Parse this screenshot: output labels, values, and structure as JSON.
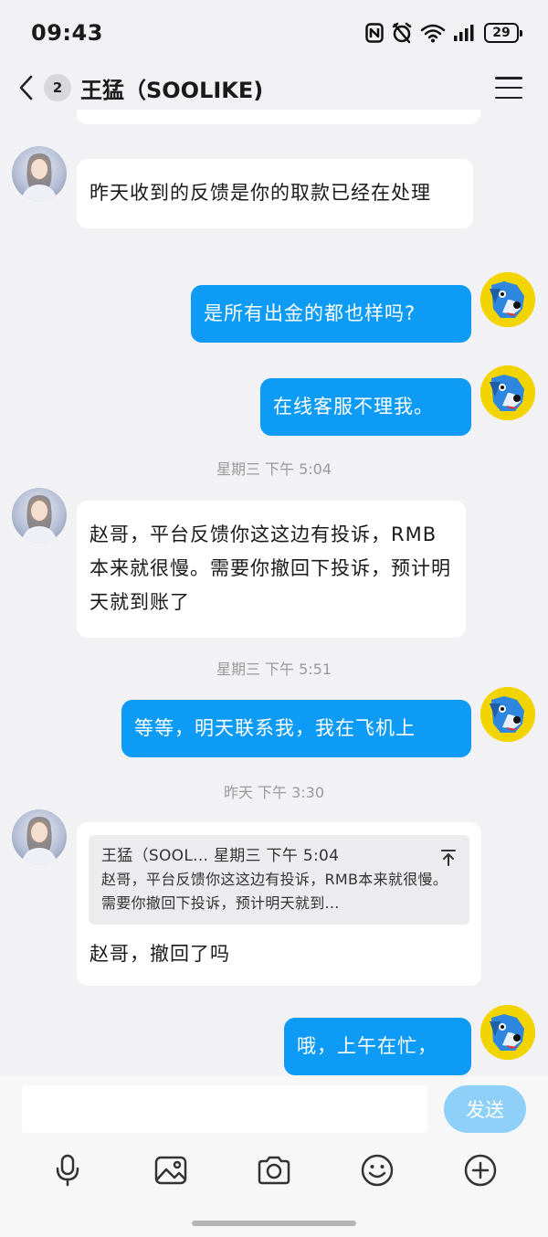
{
  "status_bar": {
    "time": "09:43",
    "battery": "29",
    "icons": [
      "nfc-icon",
      "alarm-off-icon",
      "wifi-icon",
      "signal-icon",
      "battery-icon"
    ]
  },
  "nav": {
    "unread_count": "2",
    "title": "王猛（SOOLIKE)"
  },
  "messages": [
    {
      "side": "in",
      "text": "昨天收到的反馈是你的取款已经在处理"
    },
    {
      "side": "out",
      "text": "是所有出金的都也样吗?"
    },
    {
      "side": "out",
      "text": "在线客服不理我。"
    },
    {
      "type": "time",
      "text": "星期三 下午 5:04"
    },
    {
      "side": "in",
      "text": "赵哥，平台反馈你这这边有投诉，RMB本来就很慢。需要你撤回下投诉，预计明天就到账了"
    },
    {
      "type": "time",
      "text": "星期三 下午 5:51"
    },
    {
      "side": "out",
      "text": "等等，明天联系我，我在飞机上"
    },
    {
      "type": "time",
      "text": "昨天 下午 3:30"
    },
    {
      "side": "in",
      "quote": {
        "head": "王猛（SOOL... 星期三 下午 5:04",
        "body": "赵哥，平台反馈你这这边有投诉，RMB本来就很慢。需要你撤回下投诉，预计明天就到..."
      },
      "text": "赵哥，撤回了吗"
    },
    {
      "side": "out",
      "text": "哦，上午在忙，"
    }
  ],
  "input": {
    "value": "",
    "send_label": "发送"
  },
  "toolbar": [
    "microphone-icon",
    "image-icon",
    "camera-icon",
    "emoji-icon",
    "plus-icon"
  ],
  "colors": {
    "outgoing_bubble": "#0d9bf5",
    "incoming_bubble": "#ffffff",
    "background": "#f2f2f4",
    "send_button": "#8fd0f8"
  }
}
